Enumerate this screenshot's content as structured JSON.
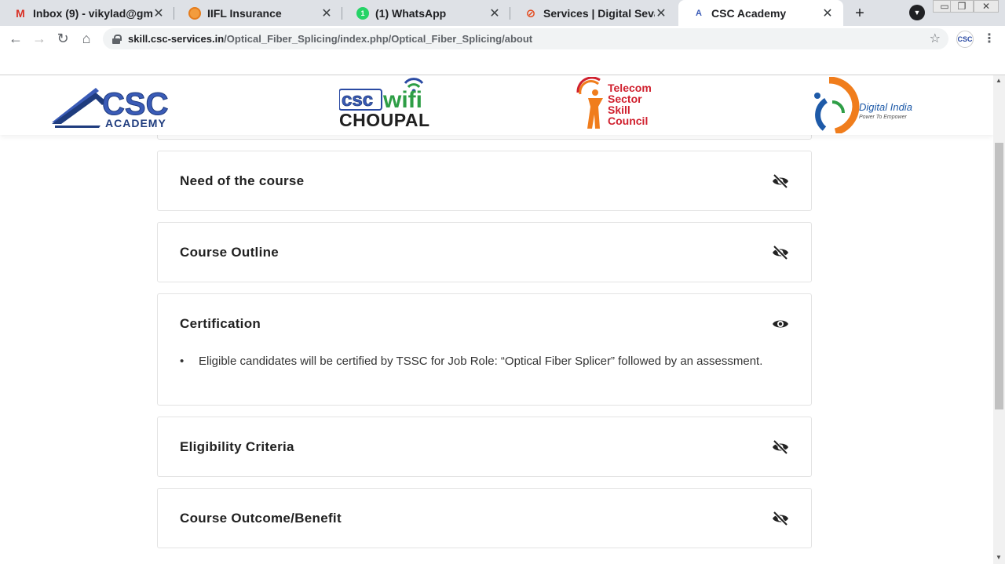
{
  "browser": {
    "tabs": [
      {
        "title": "Inbox (9) - vikylad@gm",
        "icon": "gmail-icon"
      },
      {
        "title": "IIFL Insurance",
        "icon": "iifl-icon"
      },
      {
        "title": "(1) WhatsApp",
        "icon": "whatsapp-icon",
        "badge": "1"
      },
      {
        "title": "Services | Digital Seva I",
        "icon": "digital-seva-icon"
      },
      {
        "title": "CSC Academy",
        "icon": "csc-academy-icon",
        "active": true
      }
    ],
    "close_glyph": "✕",
    "new_tab_glyph": "+",
    "url_host": "skill.csc-services.in",
    "url_path": "/Optical_Fiber_Splicing/index.php/Optical_Fiber_Splicing/about",
    "extension_label": "CSC"
  },
  "logos": {
    "csc_academy": {
      "top": "CSC",
      "bottom": "ACADEMY"
    },
    "csc_wifi": {
      "top_left": "csc",
      "top_right": "wifi",
      "bottom": "CHOUPAL"
    },
    "tssc": {
      "lines": [
        "Telecom",
        "Sector",
        "Skill",
        "Council"
      ]
    },
    "digital_india": {
      "title": "Digital India",
      "tagline": "Power To Empower"
    }
  },
  "sections": [
    {
      "title": "Need of the course",
      "expanded": false
    },
    {
      "title": "Course Outline",
      "expanded": false
    },
    {
      "title": "Certification",
      "expanded": true,
      "body": "Eligible candidates will be certified by TSSC for Job Role: “Optical Fiber Splicer” followed by an assessment."
    },
    {
      "title": "Eligibility Criteria",
      "expanded": false
    },
    {
      "title": "Course Outcome/Benefit",
      "expanded": false
    }
  ],
  "colors": {
    "csc_blue": "#3a5bb7",
    "tssc_orange": "#f07d1c",
    "tssc_red": "#d0202e",
    "digital_india_blue": "#1e5aa8",
    "wifi_green": "#2e9e46"
  }
}
